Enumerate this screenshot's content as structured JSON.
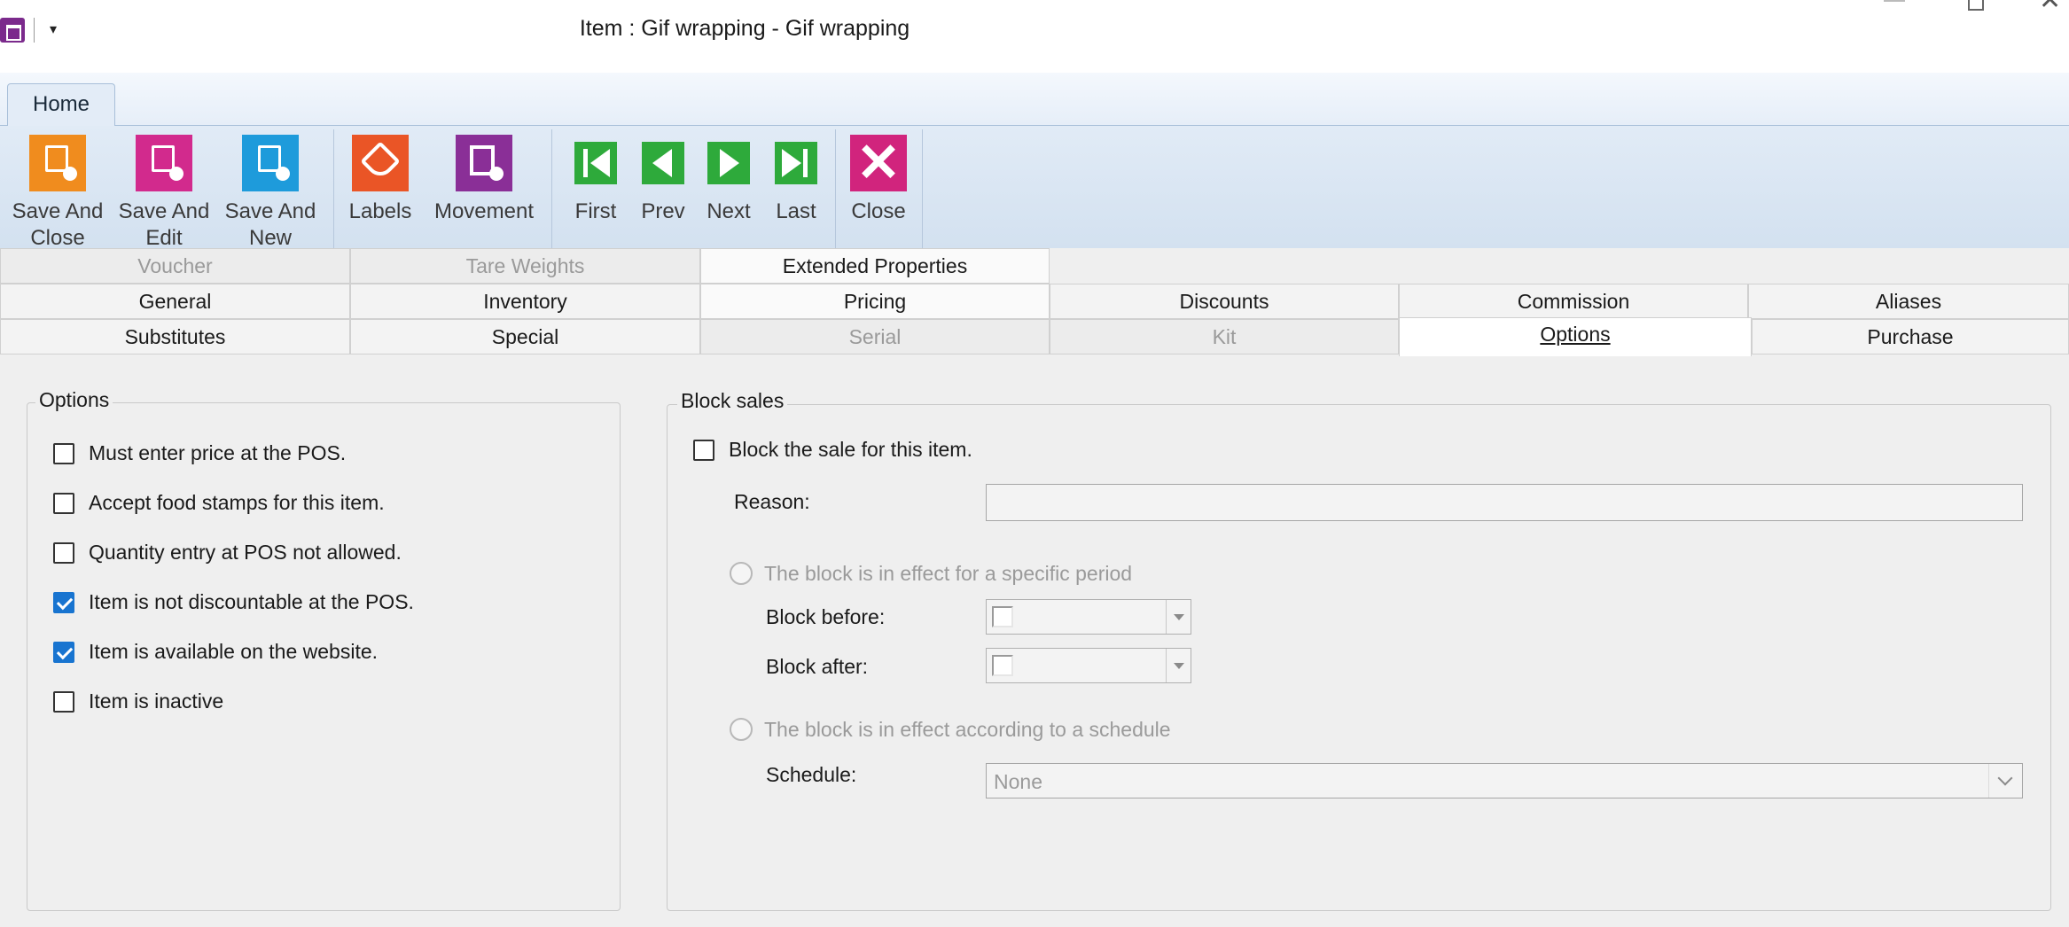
{
  "window": {
    "title": "Item : Gif wrapping - Gif wrapping",
    "quick_access": "▾",
    "close_glyph": "✕"
  },
  "ribbon": {
    "tab_home": "Home",
    "buttons": {
      "save_and_close": "Save And Close",
      "save_and_edit": "Save And Edit",
      "save_and_new": "Save And New",
      "labels": "Labels",
      "movement": "Movement",
      "first": "First",
      "prev": "Prev",
      "next": "Next",
      "last": "Last",
      "close": "Close"
    }
  },
  "tabs": {
    "row1": [
      "Voucher",
      "Tare Weights",
      "Extended Properties"
    ],
    "row2": [
      "General",
      "Inventory",
      "Pricing",
      "Discounts",
      "Commission",
      "Aliases"
    ],
    "row3": [
      "Substitutes",
      "Special",
      "Serial",
      "Kit",
      "Options",
      "Purchase"
    ],
    "active": "Options"
  },
  "options_group": {
    "title": "Options",
    "items": [
      {
        "label": "Must enter price at the POS.",
        "checked": false
      },
      {
        "label": "Accept food stamps for this item.",
        "checked": false
      },
      {
        "label": "Quantity entry at POS not allowed.",
        "checked": false
      },
      {
        "label": "Item is not discountable at the POS.",
        "checked": true
      },
      {
        "label": "Item is available on the website.",
        "checked": true
      },
      {
        "label": "Item is inactive",
        "checked": false
      }
    ]
  },
  "block_sales": {
    "title": "Block sales",
    "block_checkbox": "Block the sale for this item.",
    "reason_label": "Reason:",
    "reason_value": "",
    "period_radio": "The block is in effect for a specific period",
    "block_before_label": "Block before:",
    "block_after_label": "Block after:",
    "schedule_radio": "The block is in effect according to a schedule",
    "schedule_label": "Schedule:",
    "schedule_value": "None"
  },
  "colors": {
    "save_close": "#f08c1e",
    "save_edit": "#d22a8d",
    "save_new": "#1e9bdb",
    "labels": "#ea5526",
    "movement": "#8a2f97",
    "nav": "#2eaa3b",
    "close": "#d1247d",
    "checked": "#1874d0"
  }
}
